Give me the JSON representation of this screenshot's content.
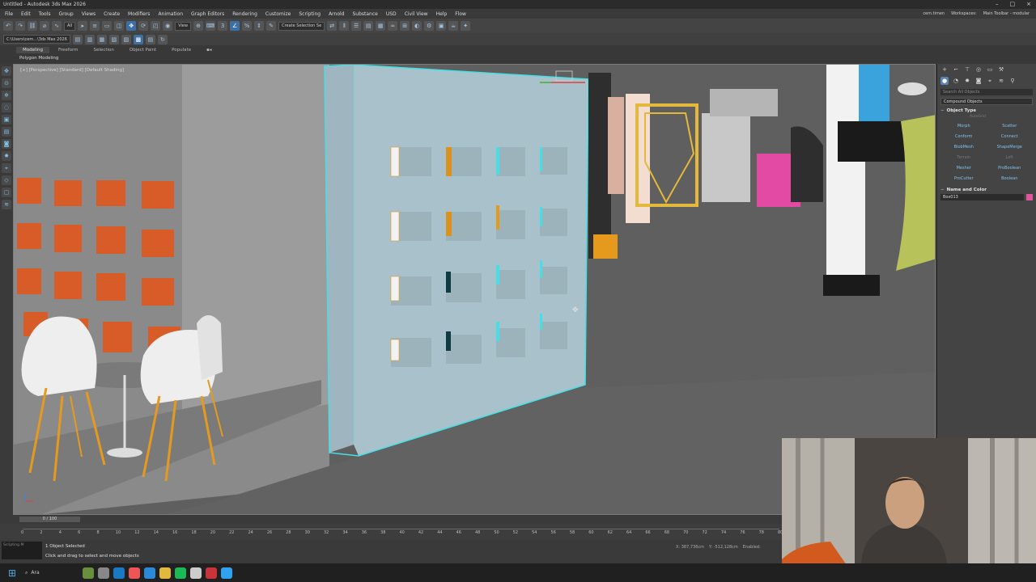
{
  "window": {
    "title": "Untitled - Autodesk 3ds Max 2026"
  },
  "menu": {
    "items": [
      "File",
      "Edit",
      "Tools",
      "Group",
      "Views",
      "Create",
      "Modifiers",
      "Animation",
      "Graph Editors",
      "Rendering",
      "Customize",
      "Scripting",
      "Arnold",
      "Substance",
      "USD",
      "Civil View",
      "Help",
      "Flow"
    ],
    "user": "cem.timen",
    "workspaces_label": "Workspaces:",
    "workspace_value": "Main Toolbar - modular"
  },
  "toolbar": {
    "filter_value": "All",
    "view_value": "View",
    "selection_set_placeholder": "Create Selection Se"
  },
  "toolbar2": {
    "path": "C:\\Users\\cem...\\3ds Max 2026"
  },
  "ribbon": {
    "tabs": [
      "Modeling",
      "Freeform",
      "Selection",
      "Object Paint",
      "Populate"
    ],
    "active_tab": "Modeling",
    "sub_label": "Polygon Modeling"
  },
  "viewport": {
    "label": "[+] [Perspective] [Standard] [Default Shading]"
  },
  "command_panel": {
    "search_placeholder": "Search All Objects",
    "category": "Compound Objects",
    "object_type_title": "Object Type",
    "autogrid_label": "AutoGrid",
    "buttons": [
      {
        "label": "Morph",
        "dim": false
      },
      {
        "label": "Scatter",
        "dim": false
      },
      {
        "label": "Conform",
        "dim": false
      },
      {
        "label": "Connect",
        "dim": false
      },
      {
        "label": "BlobMesh",
        "dim": false
      },
      {
        "label": "ShapeMerge",
        "dim": false
      },
      {
        "label": "Terrain",
        "dim": true
      },
      {
        "label": "Loft",
        "dim": true
      },
      {
        "label": "Mesher",
        "dim": false
      },
      {
        "label": "ProBoolean",
        "dim": false
      },
      {
        "label": "ProCutter",
        "dim": false
      },
      {
        "label": "Boolean",
        "dim": false
      }
    ],
    "name_color_title": "Name and Color",
    "object_name": "Box013",
    "object_color": "#e0559c"
  },
  "time": {
    "slider_label": "0 / 100",
    "ticks": [
      "0",
      "2",
      "4",
      "6",
      "8",
      "10",
      "12",
      "14",
      "16",
      "18",
      "20",
      "22",
      "24",
      "26",
      "28",
      "30",
      "32",
      "34",
      "36",
      "38",
      "40",
      "42",
      "44",
      "46",
      "48",
      "50",
      "52",
      "54",
      "56",
      "58",
      "60",
      "62",
      "64",
      "66",
      "68",
      "70",
      "72",
      "74",
      "76",
      "78",
      "80"
    ]
  },
  "status": {
    "maxscript_label": "Scripting M",
    "selection": "1 Object Selected",
    "prompt": "Click and drag to select and move objects",
    "x_value": "X: 387,736cm",
    "y_value": "Y: -512,128cm",
    "grid_label": "Enabled:"
  },
  "taskbar": {
    "search_label": "Ara",
    "start_icon": "windows-icon",
    "apps": [
      "#6a8f3c",
      "#888",
      "#1b78c2",
      "#e55",
      "#2a8ad8",
      "#e2b93b",
      "#1db954",
      "#ccc",
      "#c8343a",
      "#2ea3f2"
    ]
  },
  "colors": {
    "wall": "#a9c1cb",
    "selection_highlight": "#45e0e6",
    "accent_orange": "#d75c28",
    "chair_leg": "#e59a1e"
  }
}
